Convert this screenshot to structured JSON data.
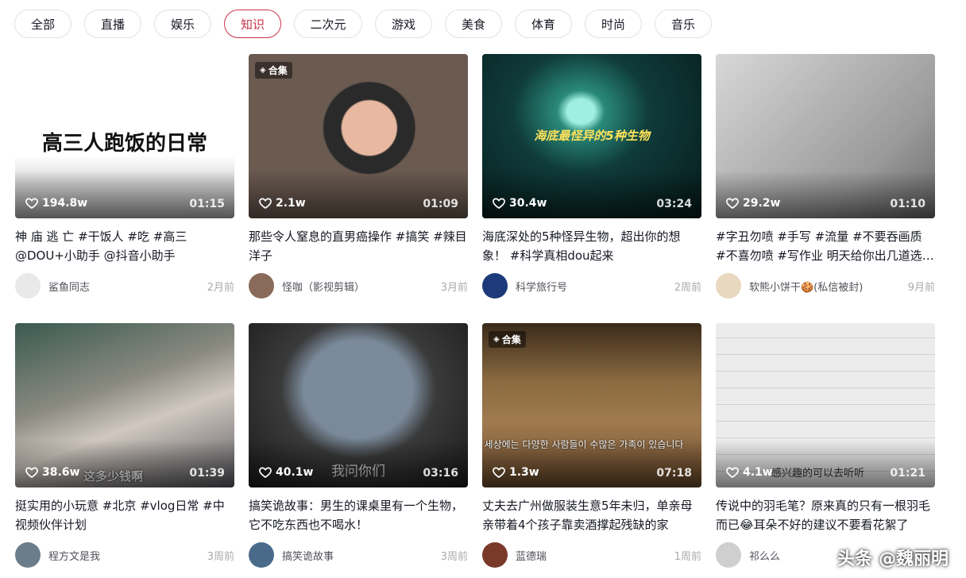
{
  "tabs": [
    {
      "label": "全部",
      "width": 72
    },
    {
      "label": "直播",
      "width": 72
    },
    {
      "label": "娱乐",
      "width": 72
    },
    {
      "label": "知识",
      "width": 72,
      "active": true
    },
    {
      "label": "二次元",
      "width": 86
    },
    {
      "label": "游戏",
      "width": 72
    },
    {
      "label": "美食",
      "width": 72
    },
    {
      "label": "体育",
      "width": 72
    },
    {
      "label": "时尚",
      "width": 72
    },
    {
      "label": "音乐",
      "width": 72
    }
  ],
  "videos": [
    {
      "likes": "194.8w",
      "duration": "01:15",
      "title": "神 庙 逃 亡 #干饭人 #吃 #高三 @DOU+小助手 @抖音小助手",
      "author": "鲨鱼同志",
      "time": "2月前",
      "overlay": "高三人跑饭的日常",
      "collection": false,
      "avatar_color": "#e9e9e9"
    },
    {
      "likes": "2.1w",
      "duration": "01:09",
      "title": "那些令人窒息的直男癌操作 #搞笑 #辣目洋子",
      "author": "怪咖（影视剪辑）",
      "time": "3月前",
      "overlay": "",
      "collection": true,
      "avatar_color": "#8a6a5a"
    },
    {
      "likes": "30.4w",
      "duration": "03:24",
      "title": "海底深处的5种怪异生物，超出你的想象！ #科学真相dou起来",
      "author": "科学旅行号",
      "time": "2周前",
      "overlay": "海底最怪异的5种生物",
      "collection": false,
      "avatar_color": "#1d3b7a"
    },
    {
      "likes": "29.2w",
      "duration": "01:10",
      "title": "#字丑勿喷 #手写 #流量 #不要吞画质 #不喜勿喷 #写作业 明天给你出几道选择题",
      "author": "软熊小饼干🍪(私信被封)",
      "time": "9月前",
      "overlay": "",
      "collection": false,
      "avatar_color": "#e8d8c0"
    },
    {
      "likes": "38.6w",
      "duration": "01:39",
      "title": "挺实用的小玩意 #北京 #vlog日常 #中视频伙伴计划",
      "author": "程方文是我",
      "time": "3周前",
      "overlay": "这多少钱啊",
      "collection": false,
      "avatar_color": "#6b7c8a"
    },
    {
      "likes": "40.1w",
      "duration": "03:16",
      "title": "搞笑诡故事：男生的课桌里有一个生物，它不吃东西也不喝水！",
      "author": "搞笑诡故事",
      "time": "3周前",
      "overlay": "我问你们",
      "collection": false,
      "avatar_color": "#4a6a8a"
    },
    {
      "likes": "1.3w",
      "duration": "07:18",
      "title": "丈夫去广州做服装生意5年未归，单亲母亲带着4个孩子靠卖酒撑起残缺的家",
      "author": "蓝德瑞",
      "time": "1周前",
      "overlay": "세상에는 다양한 사람들이 수많은 가족이 있습니다",
      "collection": true,
      "avatar_color": "#7a3a2a"
    },
    {
      "likes": "4.1w",
      "duration": "01:21",
      "title": "传说中的羽毛笔？原来真的只有一根羽毛而已😂耳朵不好的建议不要看花絮了",
      "author": "祁么么",
      "time": "3周前",
      "overlay": "感兴趣的可以去听听",
      "collection": false,
      "avatar_color": "#cfcfcf"
    }
  ],
  "collection_label": "合集",
  "watermark": {
    "platform": "头条",
    "handle": "@魏丽明"
  }
}
